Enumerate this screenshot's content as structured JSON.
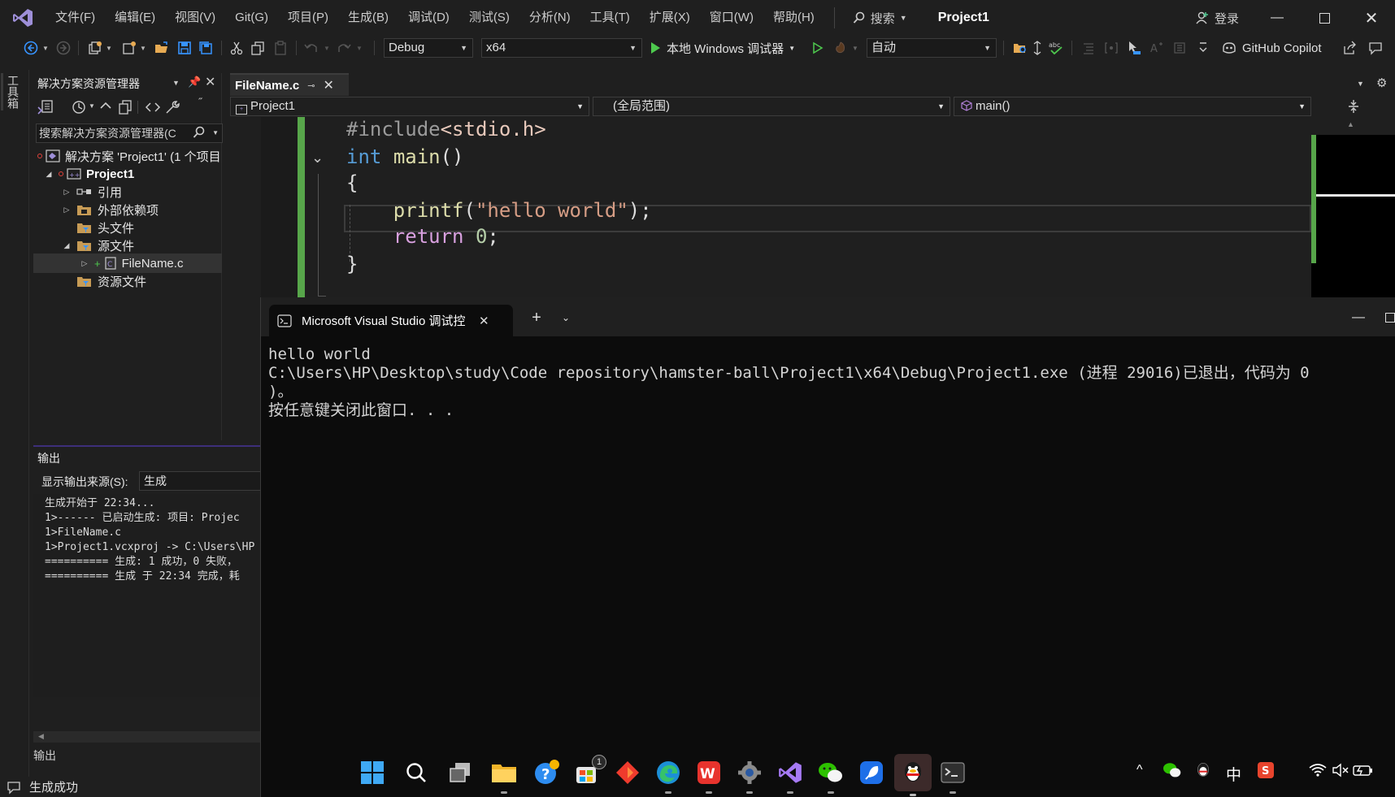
{
  "menubar": {
    "items": [
      "文件(F)",
      "编辑(E)",
      "视图(V)",
      "Git(G)",
      "项目(P)",
      "生成(B)",
      "调试(D)",
      "测试(S)",
      "分析(N)",
      "工具(T)",
      "扩展(X)",
      "窗口(W)",
      "帮助(H)"
    ],
    "search_label": "搜索",
    "project_title": "Project1",
    "login_label": "登录"
  },
  "toolbar": {
    "config": "Debug",
    "platform": "x64",
    "run_label": "本地 Windows 调试器",
    "auto_label": "自动",
    "copilot_label": "GitHub Copilot"
  },
  "toolbox": {
    "label": "工具箱"
  },
  "solution_explorer": {
    "title": "解决方案资源管理器",
    "search_placeholder": "搜索解决方案资源管理器(C",
    "tree": [
      {
        "label": "解决方案 'Project1' (1 个项目",
        "icon": "solution-icon"
      },
      {
        "label": "Project1",
        "icon": "project-icon"
      },
      {
        "label": "引用",
        "icon": "references-icon"
      },
      {
        "label": "外部依赖项",
        "icon": "external-deps-icon"
      },
      {
        "label": "头文件",
        "icon": "folder-icon"
      },
      {
        "label": "源文件",
        "icon": "folder-icon"
      },
      {
        "label": "FileName.c",
        "icon": "c-file-icon"
      },
      {
        "label": "资源文件",
        "icon": "folder-icon"
      }
    ]
  },
  "editor": {
    "tab_label": "FileName.c",
    "nav_project": "Project1",
    "nav_scope": "(全局范围)",
    "nav_member": "main()",
    "code": {
      "line1_directive": "#include",
      "line1_header": "<stdio.h>",
      "line2_kw": "int",
      "line2_fn": "main",
      "line2_paren": "()",
      "line3": "{",
      "line4_fn": "printf",
      "line4_open": "(",
      "line4_str": "\"hello world\"",
      "line4_close": ");",
      "line5_kw": "return",
      "line5_num": "0",
      "line5_semi": ";",
      "line6": "}"
    }
  },
  "output": {
    "title": "输出",
    "source_label": "显示输出来源(S):",
    "source_value": "生成",
    "lines": [
      "生成开始于 22:34...",
      "1>------ 已启动生成: 项目: Projec",
      "1>FileName.c",
      "1>Project1.vcxproj -> C:\\Users\\HP",
      "========== 生成: 1 成功，0 失败，",
      "========== 生成 于 22:34 完成，耗"
    ],
    "bottom_tab": "输出"
  },
  "statusbar": {
    "text": "生成成功"
  },
  "console": {
    "tab_title": "Microsoft Visual Studio 调试控",
    "lines": [
      "hello world",
      "C:\\Users\\HP\\Desktop\\study\\Code repository\\hamster-ball\\Project1\\x64\\Debug\\Project1.exe (进程 29016)已退出，代码为 0",
      ")。",
      "按任意键关闭此窗口. . ."
    ]
  },
  "taskbar": {
    "help_badge": "",
    "store_badge": "1",
    "ime_label": "中"
  }
}
